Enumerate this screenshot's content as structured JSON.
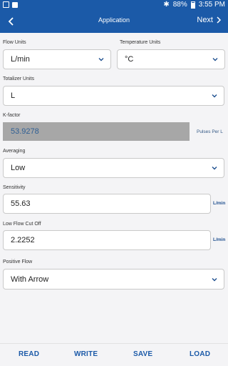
{
  "status": {
    "battery": "88%",
    "time": "3:55 PM"
  },
  "appbar": {
    "title": "Application",
    "next_label": "Next"
  },
  "fields": {
    "flow_units": {
      "label": "Flow Units",
      "value": "L/min"
    },
    "temperature_units": {
      "label": "Temperature Units",
      "value": "°C"
    },
    "totalizer_units": {
      "label": "Totalizer Units",
      "value": "L"
    },
    "k_factor": {
      "label": "K-factor",
      "value": "53.9278",
      "unit": "Pulses Per L"
    },
    "averaging": {
      "label": "Averaging",
      "value": "Low"
    },
    "sensitivity": {
      "label": "Sensitivity",
      "value": "55.63",
      "unit": "L/min"
    },
    "low_flow_cut_off": {
      "label": "Low Flow Cut Off",
      "value": "2.2252",
      "unit": "L/min"
    },
    "positive_flow": {
      "label": "Positive Flow",
      "value": "With Arrow"
    }
  },
  "actions": {
    "read": "READ",
    "write": "WRITE",
    "save": "SAVE",
    "load": "LOAD"
  },
  "colors": {
    "primary": "#1b5aa8",
    "background": "#f4f4f6",
    "disabled_field": "#a7a7a7"
  }
}
